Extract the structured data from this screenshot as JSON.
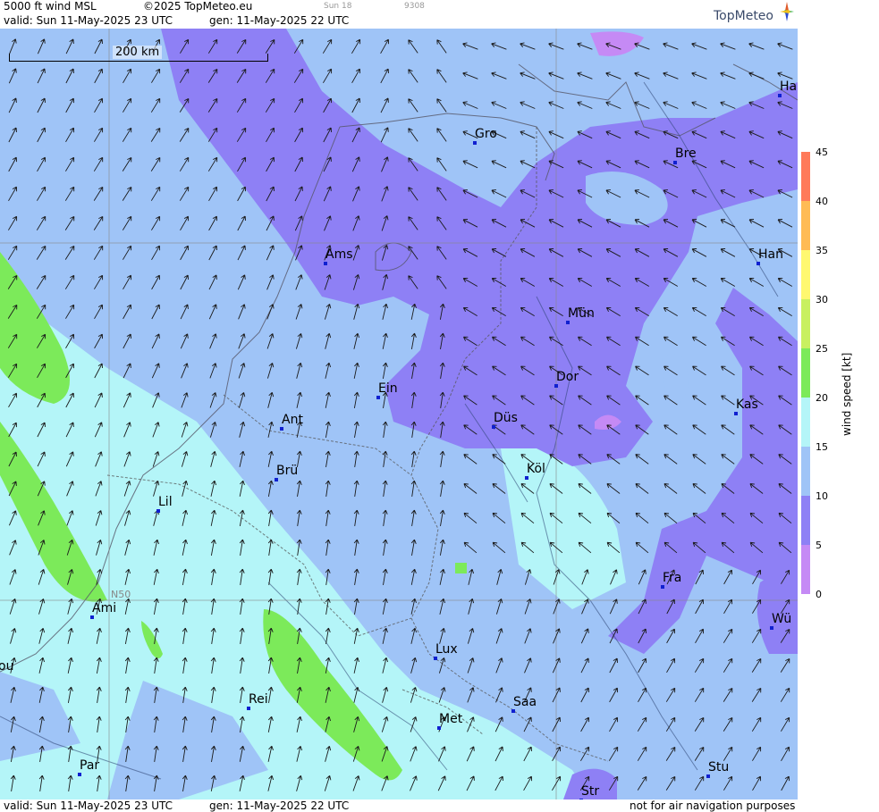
{
  "header": {
    "title": "5000 ft wind MSL",
    "copyright": "©2025 TopMeteo.eu",
    "day_small": "Sun 18",
    "code_small": "9308",
    "valid": "valid:  Sun  11-May-2025  23 UTC",
    "generated": "gen: 11-May-2025 22 UTC",
    "logo": "TopMeteo"
  },
  "footer": {
    "valid": "valid:  Sun  11-May-2025  23 UTC",
    "generated": "gen: 11-May-2025 22 UTC",
    "disclaimer": "not for air navigation purposes"
  },
  "scale": {
    "label": "200 km"
  },
  "grid_label": "N50",
  "legend": {
    "title": "wind  speed  [kt]",
    "ticks": [
      "45",
      "40",
      "35",
      "30",
      "25",
      "20",
      "15",
      "10",
      "5",
      "0"
    ],
    "colors": {
      "0-5": "#c58af5",
      "5-10": "#8e80f5",
      "10-15": "#9fc4f7",
      "15-20": "#b4f5f8",
      "20-25": "#7cea5a",
      "25-30": "#c8f060",
      "30-35": "#fff870",
      "35-40": "#ffbb55",
      "40-45": "#ff7a5a"
    }
  },
  "cities": [
    {
      "name": "Gro"
    },
    {
      "name": "Bre"
    },
    {
      "name": "Ha"
    },
    {
      "name": "Ams"
    },
    {
      "name": "Han"
    },
    {
      "name": "Mün"
    },
    {
      "name": "Ein"
    },
    {
      "name": "Dor"
    },
    {
      "name": "Ant"
    },
    {
      "name": "Kas"
    },
    {
      "name": "Düs"
    },
    {
      "name": "Brü"
    },
    {
      "name": "Köl"
    },
    {
      "name": "Lil"
    },
    {
      "name": "Fra"
    },
    {
      "name": "Ami"
    },
    {
      "name": "Wü"
    },
    {
      "name": "Lux"
    },
    {
      "name": "ou"
    },
    {
      "name": "Rei"
    },
    {
      "name": "Saa"
    },
    {
      "name": "Met"
    },
    {
      "name": "Par"
    },
    {
      "name": "Stu"
    },
    {
      "name": "Str"
    }
  ]
}
